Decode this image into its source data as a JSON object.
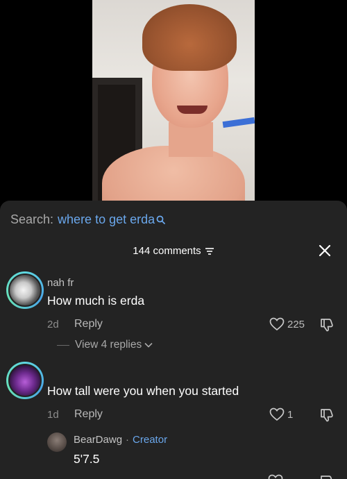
{
  "video": {
    "caption": ""
  },
  "search": {
    "label": "Search:",
    "query": "where to get erda"
  },
  "comments_panel": {
    "count_label": "144 comments"
  },
  "comments": [
    {
      "username": "nah fr",
      "text": "How much is erda",
      "time": "2d",
      "reply_label": "Reply",
      "likes": "225",
      "view_replies": "View 4 replies"
    },
    {
      "username": "",
      "text": "How tall were you when you started",
      "time": "1d",
      "reply_label": "Reply",
      "likes": "1"
    }
  ],
  "creator_reply": {
    "username": "BearDawg",
    "separator": "·",
    "badge": "Creator",
    "text": "5'7.5"
  },
  "colors": {
    "sheet_bg": "#232323",
    "accent_blue": "#6aa7ec"
  }
}
